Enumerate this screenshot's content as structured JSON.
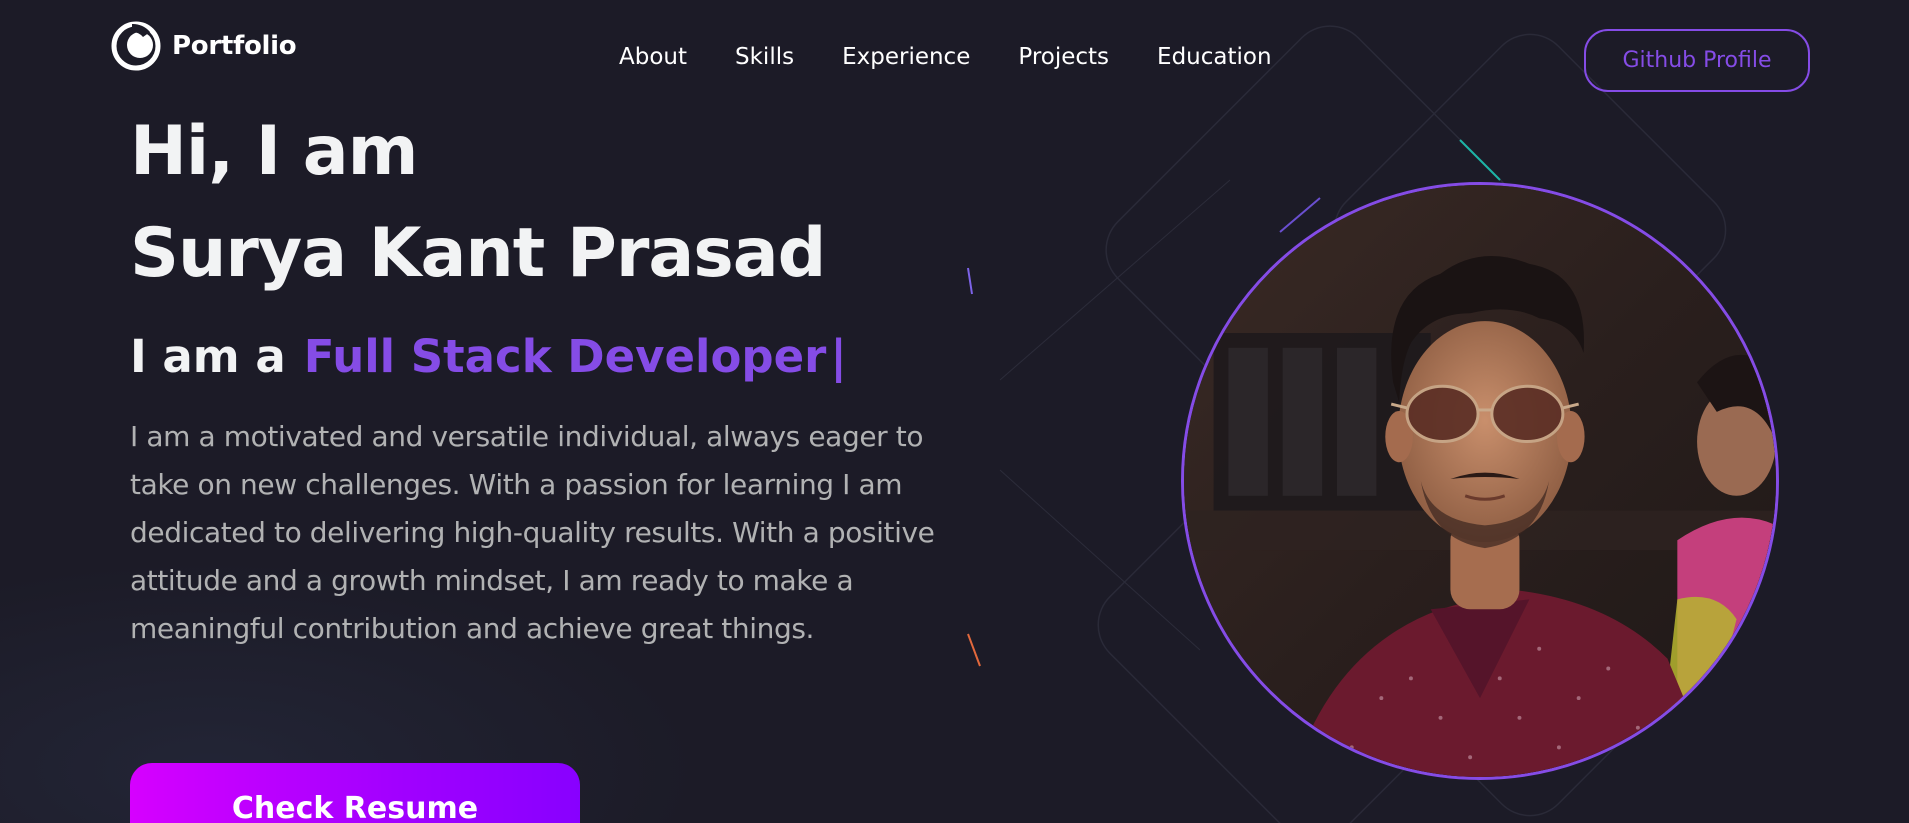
{
  "brand": {
    "name": "Portfolio",
    "icon": "portfolio-logo-icon"
  },
  "nav": {
    "links": [
      "About",
      "Skills",
      "Experience",
      "Projects",
      "Education"
    ],
    "github_button": "Github Profile"
  },
  "hero": {
    "greeting": "Hi, I am",
    "name": "Surya Kant Prasad",
    "role_prefix": "I am a",
    "role_value": "Full Stack Developer",
    "role_cursor": "|",
    "description": "I am a motivated and versatile individual, always eager to take on new challenges. With a passion for learning I am dedicated to delivering high-quality results. With a positive attitude and a growth mindset, I am ready to make a meaningful contribution and achieve great things.",
    "resume_button": "Check Resume"
  },
  "colors": {
    "background": "#1c1b27",
    "accent": "#854ce6",
    "text_primary": "#f2f3f4",
    "text_secondary": "#b1b2b3",
    "button_gradient_start": "#d600ff",
    "button_gradient_end": "#8800ff"
  }
}
